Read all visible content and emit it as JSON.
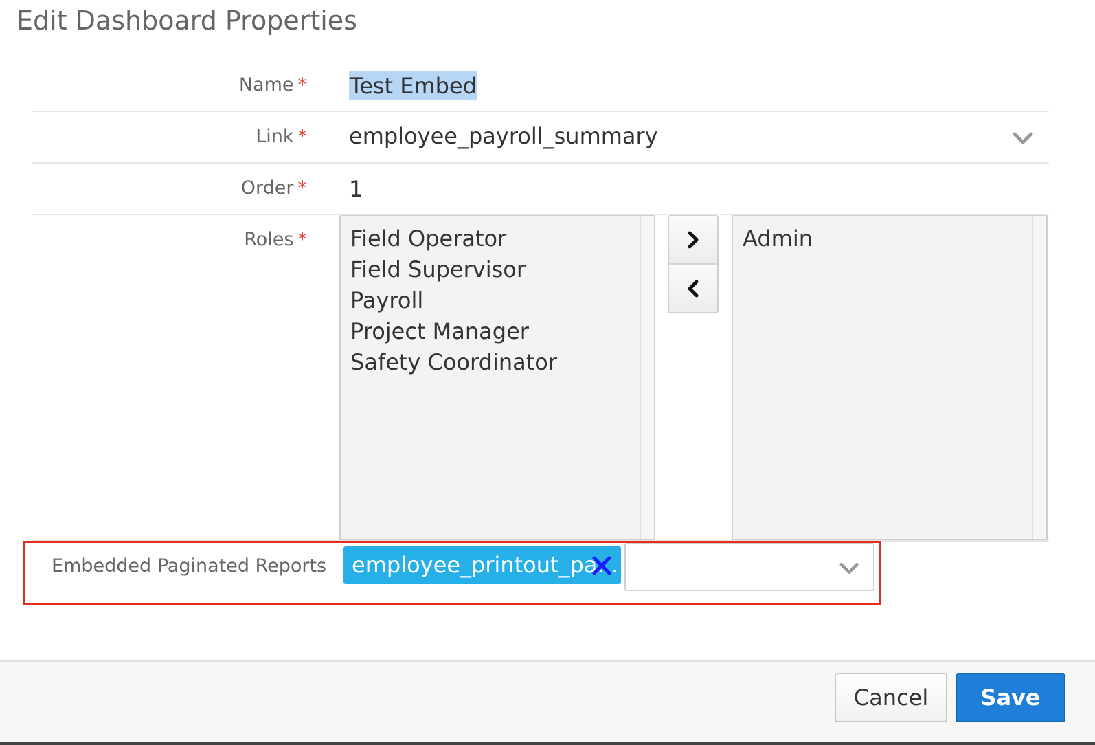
{
  "dialog": {
    "title": "Edit Dashboard Properties"
  },
  "fields": {
    "name": {
      "label": "Name",
      "required_mark": "*",
      "value": "Test Embed"
    },
    "link": {
      "label": "Link",
      "required_mark": "*",
      "value": "employee_payroll_summary",
      "icon": "chevron-down-icon"
    },
    "order": {
      "label": "Order",
      "required_mark": "*",
      "value": "1"
    },
    "roles": {
      "label": "Roles",
      "required_mark": "*",
      "available": [
        "Field Operator",
        "Field Supervisor",
        "Payroll",
        "Project Manager",
        "Safety Coordinator"
      ],
      "selected": [
        "Admin"
      ],
      "move_right_icon": "chevron-right-icon",
      "move_left_icon": "chevron-left-icon"
    },
    "embedded_reports": {
      "label": "Embedded Paginated Reports",
      "tags": [
        "employee_printout_pa..."
      ],
      "remove_icon": "close-icon",
      "dropdown_icon": "chevron-down-icon"
    }
  },
  "footer": {
    "cancel_label": "Cancel",
    "save_label": "Save"
  },
  "colors": {
    "required": "#e0453a",
    "tag_bg": "#27b0e8",
    "tag_remove": "#1a1aff",
    "primary": "#1f7fd8",
    "highlight_border": "#e22d1f",
    "selection": "#b7d5f5"
  }
}
